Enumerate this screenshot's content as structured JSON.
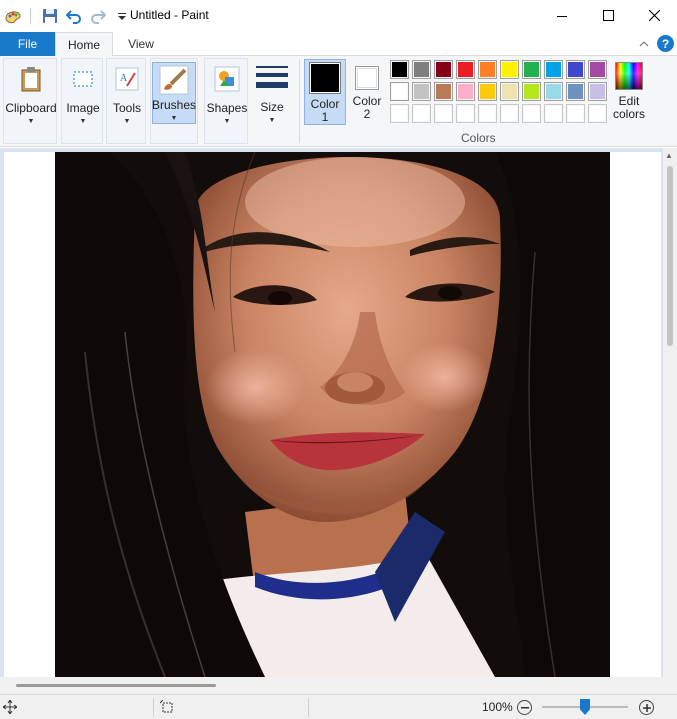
{
  "window": {
    "title": "Untitled - Paint"
  },
  "tabs": {
    "file": "File",
    "home": "Home",
    "view": "View"
  },
  "help": "?",
  "ribbon": {
    "clipboard": "Clipboard",
    "image": "Image",
    "tools": "Tools",
    "brushes": "Brushes",
    "shapes": "Shapes",
    "size": "Size",
    "color1": "Color\n1",
    "color1_a": "Color",
    "color1_b": "1",
    "color2_a": "Color",
    "color2_b": "2",
    "edit_a": "Edit",
    "edit_b": "colors",
    "colors_group": "Colors"
  },
  "palette": {
    "row1": [
      "#000000",
      "#7f7f7f",
      "#880015",
      "#ed1c24",
      "#ff7f27",
      "#fff200",
      "#22b14c",
      "#00a2e8",
      "#3f48cc",
      "#a349a4"
    ],
    "row2": [
      "#ffffff",
      "#c3c3c3",
      "#b97a57",
      "#ffaec9",
      "#ffc90e",
      "#efe4b0",
      "#b5e61d",
      "#99d9ea",
      "#7092be",
      "#c8bfe7"
    ],
    "color1": "#000000",
    "color2": "#ffffff"
  },
  "status": {
    "zoom": "100%"
  }
}
